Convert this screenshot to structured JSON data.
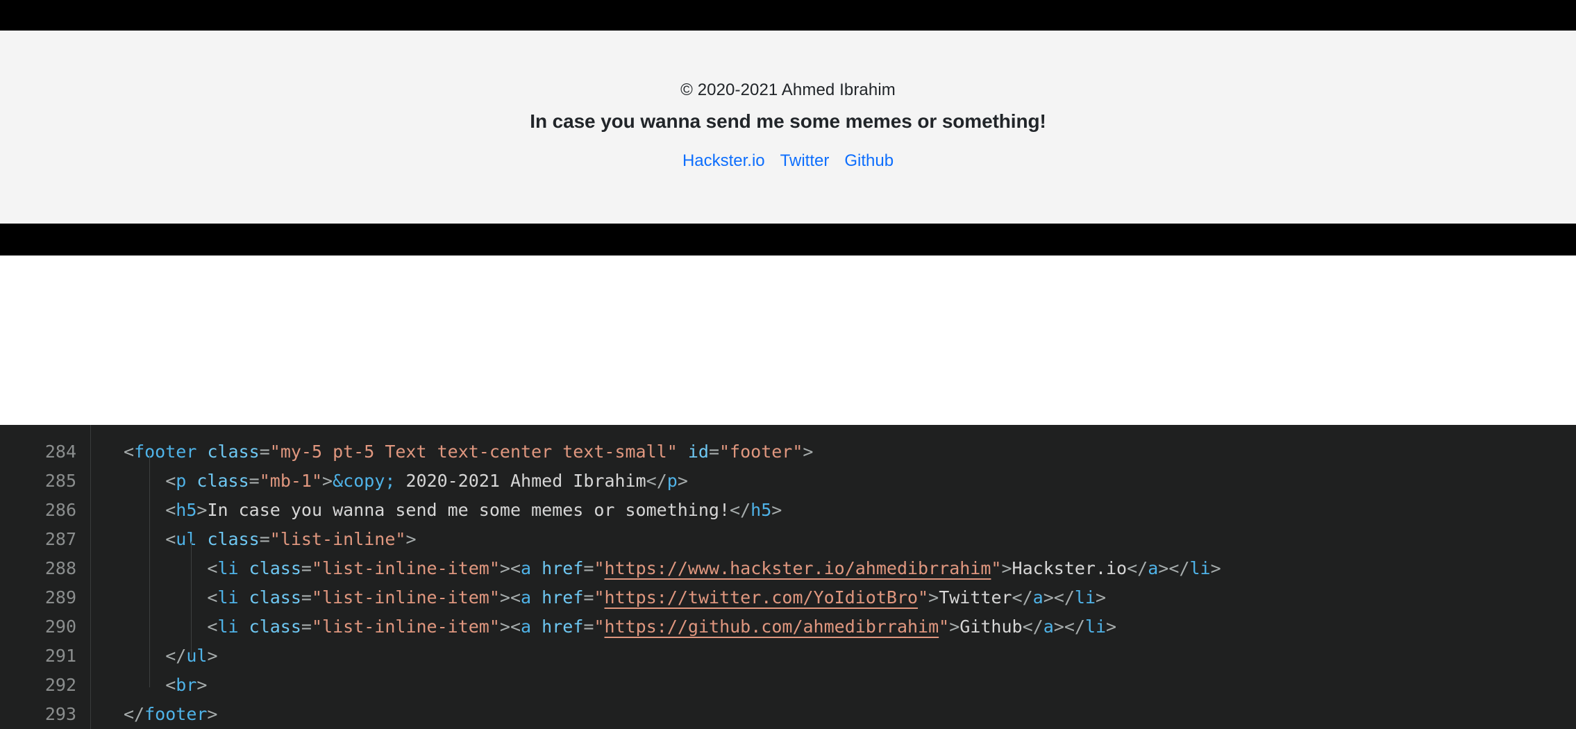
{
  "preview": {
    "footer": {
      "copyright": "© 2020-2021 Ahmed Ibrahim",
      "tagline": "In case you wanna send me some memes or something!",
      "links": [
        {
          "label": "Hackster.io",
          "color": "#0d6efd"
        },
        {
          "label": "Twitter",
          "color": "#0d6efd"
        },
        {
          "label": "Github",
          "color": "#0d6efd"
        }
      ],
      "background": "#f4f4f4",
      "link_color": "#0d6efd"
    },
    "bars": {
      "color": "#000000"
    }
  },
  "editor": {
    "background": "#1f2020",
    "line_number_color": "#8b8e8e",
    "lines": [
      {
        "number": "284",
        "tokens": [
          {
            "t": "punc",
            "v": "<"
          },
          {
            "t": "tag",
            "v": "footer"
          },
          {
            "t": "txt",
            "v": " "
          },
          {
            "t": "attr",
            "v": "class"
          },
          {
            "t": "punc",
            "v": "="
          },
          {
            "t": "str",
            "v": "\"my-5 pt-5 Text text-center text-small\""
          },
          {
            "t": "txt",
            "v": " "
          },
          {
            "t": "attr",
            "v": "id"
          },
          {
            "t": "punc",
            "v": "="
          },
          {
            "t": "str",
            "v": "\"footer\""
          },
          {
            "t": "punc",
            "v": ">"
          }
        ]
      },
      {
        "number": "285",
        "tokens": [
          {
            "t": "txt",
            "v": "    "
          },
          {
            "t": "punc",
            "v": "<"
          },
          {
            "t": "tag",
            "v": "p"
          },
          {
            "t": "txt",
            "v": " "
          },
          {
            "t": "attr",
            "v": "class"
          },
          {
            "t": "punc",
            "v": "="
          },
          {
            "t": "str",
            "v": "\"mb-1\""
          },
          {
            "t": "punc",
            "v": ">"
          },
          {
            "t": "ent",
            "v": "&copy;"
          },
          {
            "t": "txt",
            "v": " 2020-2021 Ahmed Ibrahim"
          },
          {
            "t": "punc",
            "v": "</"
          },
          {
            "t": "tag",
            "v": "p"
          },
          {
            "t": "punc",
            "v": ">"
          }
        ]
      },
      {
        "number": "286",
        "tokens": [
          {
            "t": "txt",
            "v": "    "
          },
          {
            "t": "punc",
            "v": "<"
          },
          {
            "t": "tag",
            "v": "h5"
          },
          {
            "t": "punc",
            "v": ">"
          },
          {
            "t": "txt",
            "v": "In case you wanna send me some memes or something!"
          },
          {
            "t": "punc",
            "v": "</"
          },
          {
            "t": "tag",
            "v": "h5"
          },
          {
            "t": "punc",
            "v": ">"
          }
        ]
      },
      {
        "number": "287",
        "tokens": [
          {
            "t": "txt",
            "v": "    "
          },
          {
            "t": "punc",
            "v": "<"
          },
          {
            "t": "tag",
            "v": "ul"
          },
          {
            "t": "txt",
            "v": " "
          },
          {
            "t": "attr",
            "v": "class"
          },
          {
            "t": "punc",
            "v": "="
          },
          {
            "t": "str",
            "v": "\"list-inline\""
          },
          {
            "t": "punc",
            "v": ">"
          }
        ]
      },
      {
        "number": "288",
        "tokens": [
          {
            "t": "txt",
            "v": "        "
          },
          {
            "t": "punc",
            "v": "<"
          },
          {
            "t": "tag",
            "v": "li"
          },
          {
            "t": "txt",
            "v": " "
          },
          {
            "t": "attr",
            "v": "class"
          },
          {
            "t": "punc",
            "v": "="
          },
          {
            "t": "str",
            "v": "\"list-inline-item\""
          },
          {
            "t": "punc",
            "v": ">"
          },
          {
            "t": "punc",
            "v": "<"
          },
          {
            "t": "tag",
            "v": "a"
          },
          {
            "t": "txt",
            "v": " "
          },
          {
            "t": "attr",
            "v": "href"
          },
          {
            "t": "punc",
            "v": "="
          },
          {
            "t": "str",
            "v": "\""
          },
          {
            "t": "link",
            "v": "https://www.hackster.io/ahmedibrrahim"
          },
          {
            "t": "str",
            "v": "\""
          },
          {
            "t": "punc",
            "v": ">"
          },
          {
            "t": "txt",
            "v": "Hackster.io"
          },
          {
            "t": "punc",
            "v": "</"
          },
          {
            "t": "tag",
            "v": "a"
          },
          {
            "t": "punc",
            "v": ">"
          },
          {
            "t": "punc",
            "v": "</"
          },
          {
            "t": "tag",
            "v": "li"
          },
          {
            "t": "punc",
            "v": ">"
          }
        ]
      },
      {
        "number": "289",
        "tokens": [
          {
            "t": "txt",
            "v": "        "
          },
          {
            "t": "punc",
            "v": "<"
          },
          {
            "t": "tag",
            "v": "li"
          },
          {
            "t": "txt",
            "v": " "
          },
          {
            "t": "attr",
            "v": "class"
          },
          {
            "t": "punc",
            "v": "="
          },
          {
            "t": "str",
            "v": "\"list-inline-item\""
          },
          {
            "t": "punc",
            "v": ">"
          },
          {
            "t": "punc",
            "v": "<"
          },
          {
            "t": "tag",
            "v": "a"
          },
          {
            "t": "txt",
            "v": " "
          },
          {
            "t": "attr",
            "v": "href"
          },
          {
            "t": "punc",
            "v": "="
          },
          {
            "t": "str",
            "v": "\""
          },
          {
            "t": "link",
            "v": "https://twitter.com/YoIdiotBro"
          },
          {
            "t": "str",
            "v": "\""
          },
          {
            "t": "punc",
            "v": ">"
          },
          {
            "t": "txt",
            "v": "Twitter"
          },
          {
            "t": "punc",
            "v": "</"
          },
          {
            "t": "tag",
            "v": "a"
          },
          {
            "t": "punc",
            "v": ">"
          },
          {
            "t": "punc",
            "v": "</"
          },
          {
            "t": "tag",
            "v": "li"
          },
          {
            "t": "punc",
            "v": ">"
          }
        ]
      },
      {
        "number": "290",
        "tokens": [
          {
            "t": "txt",
            "v": "        "
          },
          {
            "t": "punc",
            "v": "<"
          },
          {
            "t": "tag",
            "v": "li"
          },
          {
            "t": "txt",
            "v": " "
          },
          {
            "t": "attr",
            "v": "class"
          },
          {
            "t": "punc",
            "v": "="
          },
          {
            "t": "str",
            "v": "\"list-inline-item\""
          },
          {
            "t": "punc",
            "v": ">"
          },
          {
            "t": "punc",
            "v": "<"
          },
          {
            "t": "tag",
            "v": "a"
          },
          {
            "t": "txt",
            "v": " "
          },
          {
            "t": "attr",
            "v": "href"
          },
          {
            "t": "punc",
            "v": "="
          },
          {
            "t": "str",
            "v": "\""
          },
          {
            "t": "link",
            "v": "https://github.com/ahmedibrrahim"
          },
          {
            "t": "str",
            "v": "\""
          },
          {
            "t": "punc",
            "v": ">"
          },
          {
            "t": "txt",
            "v": "Github"
          },
          {
            "t": "punc",
            "v": "</"
          },
          {
            "t": "tag",
            "v": "a"
          },
          {
            "t": "punc",
            "v": ">"
          },
          {
            "t": "punc",
            "v": "</"
          },
          {
            "t": "tag",
            "v": "li"
          },
          {
            "t": "punc",
            "v": ">"
          }
        ]
      },
      {
        "number": "291",
        "tokens": [
          {
            "t": "txt",
            "v": "    "
          },
          {
            "t": "punc",
            "v": "</"
          },
          {
            "t": "tag",
            "v": "ul"
          },
          {
            "t": "punc",
            "v": ">"
          }
        ]
      },
      {
        "number": "292",
        "tokens": [
          {
            "t": "txt",
            "v": "    "
          },
          {
            "t": "punc",
            "v": "<"
          },
          {
            "t": "tag",
            "v": "br"
          },
          {
            "t": "punc",
            "v": ">"
          }
        ]
      },
      {
        "number": "293",
        "tokens": [
          {
            "t": "punc",
            "v": "</"
          },
          {
            "t": "tag",
            "v": "footer"
          },
          {
            "t": "punc",
            "v": ">"
          }
        ]
      }
    ]
  }
}
